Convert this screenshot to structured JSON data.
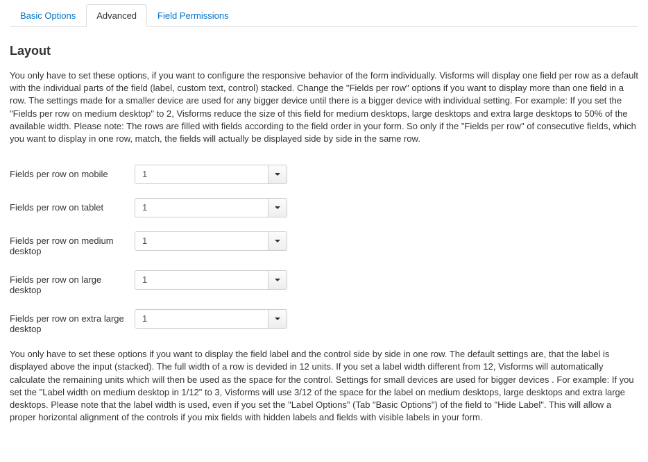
{
  "tabs": {
    "basic": "Basic Options",
    "advanced": "Advanced",
    "permissions": "Field Permissions"
  },
  "section": {
    "title": "Layout",
    "description1": "You only have to set these options, if you want to configure the responsive behavior of the form individually. Visforms will display one field per row as a default with the individual parts of the field (label, custom text, control) stacked. Change the \"Fields per row\" options if you want to display more than one field in a row. The settings made for a smaller device are used for any bigger device until there is a bigger device with individual setting. For example: If you set the \"Fields per row on medium desktop\" to 2, Visforms reduce the size of this field for medium desktops, large desktops and extra large desktops to 50% of the available width. Please note: The rows are filled with fields according to the field order in your form. So only if the \"Fields per row\" of consecutive fields, which you want to display in one row, match, the fields will actually be displayed side by side in the same row.",
    "description2": "You only have to set these options if you want to display the field label and the control side by side in one row. The default settings are, that the label is displayed above the input (stacked). The full width of a row is devided in 12 units. If you set a label width different from 12, Visforms will automatically calculate the remaining units which will then be used as the space for the control. Settings for small devices are used for bigger devices . For example: If you set the \"Label width on medium desktop in 1/12\" to 3, Visforms will use 3/12 of the space for the label on medium desktops, large desktops and extra large desktops. Please note that the label width is used, even if you set the \"Label Options\" (Tab \"Basic Options\") of the field to \"Hide Label\". This will allow a proper horizontal alignment of the controls if you mix fields with hidden labels and fields with visible labels in your form."
  },
  "fields": {
    "mobile": {
      "label": "Fields per row on mobile",
      "value": "1"
    },
    "tablet": {
      "label": "Fields per row on tablet",
      "value": "1"
    },
    "medium": {
      "label": "Fields per row on medium desktop",
      "value": "1"
    },
    "large": {
      "label": "Fields per row on large desktop",
      "value": "1"
    },
    "xlarge": {
      "label": "Fields per row on extra large desktop",
      "value": "1"
    }
  }
}
